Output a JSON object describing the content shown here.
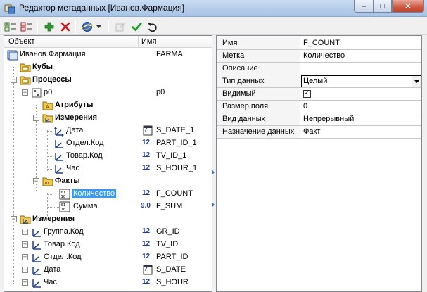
{
  "window": {
    "title": "Редактор метаданных [Иванов.Фармация]",
    "minimize": "–",
    "maximize": "□",
    "close": "✕"
  },
  "toolbar": {
    "icons": [
      "add-node-icon",
      "remove-node-icon",
      "add-icon",
      "delete-icon",
      "globe-icon",
      "dropdown-arrow-icon",
      "edit-icon",
      "check-icon",
      "undo-icon"
    ]
  },
  "tree": {
    "columns": {
      "object": "Объект",
      "name": "Имя"
    },
    "rows": [
      {
        "label": "Иванов.Фармация",
        "value": "FARMA"
      },
      {
        "label": "Кубы"
      },
      {
        "label": "Процессы"
      },
      {
        "label": "p0",
        "value": "p0"
      },
      {
        "label": "Атрибуты"
      },
      {
        "label": "Измерения"
      },
      {
        "label": "Дата",
        "type": "7",
        "value": "S_DATE_1"
      },
      {
        "label": "Отдел.Код",
        "type": "12",
        "value": "PART_ID_1"
      },
      {
        "label": "Товар.Код",
        "type": "12",
        "value": "TV_ID_1"
      },
      {
        "label": "Час",
        "type": "12",
        "value": "S_HOUR_1"
      },
      {
        "label": "Факты"
      },
      {
        "label": "Количество",
        "type": "12",
        "value": "F_COUNT"
      },
      {
        "label": "Сумма",
        "type": "9.0",
        "value": "F_SUM"
      },
      {
        "label": "Измерения"
      },
      {
        "label": "Группа.Код",
        "type": "12",
        "value": "GR_ID"
      },
      {
        "label": "Товар.Код",
        "type": "12",
        "value": "TV_ID"
      },
      {
        "label": "Отдел.Код",
        "type": "12",
        "value": "PART_ID"
      },
      {
        "label": "Дата",
        "type": "7",
        "value": "S_DATE"
      },
      {
        "label": "Час",
        "type": "12",
        "value": "S_HOUR"
      }
    ]
  },
  "properties": [
    {
      "name": "Имя",
      "value": "F_COUNT"
    },
    {
      "name": "Метка",
      "value": "Количество"
    },
    {
      "name": "Описание",
      "value": ""
    },
    {
      "name": "Тип данных",
      "value": "Целый"
    },
    {
      "name": "Видимый",
      "value": "✓"
    },
    {
      "name": "Размер поля",
      "value": "0"
    },
    {
      "name": "Вид данных",
      "value": "Непрерывный"
    },
    {
      "name": "Назначение данных",
      "value": "Факт"
    }
  ],
  "colors": {
    "selection": "#3399ff",
    "type_badge": "#1a3aa8",
    "folder": "#f2c94c"
  }
}
